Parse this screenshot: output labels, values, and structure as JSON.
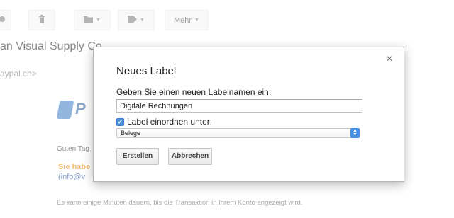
{
  "background": {
    "toolbar": {
      "more_label": "Mehr"
    },
    "subject": "an Visual Supply Co",
    "sender": "aypal.ch>",
    "logo_text": "P",
    "side_mark": "z\nz",
    "greeting": "Guten Tag",
    "orange_text": "Sie habe",
    "link_text": "(info@v",
    "note": "Es kann einige Minuten dauern, bis die Transaktion in Ihrem Konto angezeigt wird."
  },
  "dialog": {
    "title": "Neues Label",
    "prompt": "Geben Sie einen neuen Labelnamen ein:",
    "name_value": "Digitale Rechnungen",
    "nest_label": "Label einordnen unter:",
    "nest_checked": true,
    "parent_selected": "Belege",
    "create_label": "Erstellen",
    "cancel_label": "Abbrechen",
    "close_symbol": "×"
  },
  "colors": {
    "accent": "#4a90e2",
    "paypal_blue": "#2d5fa0",
    "orange": "#e68a00"
  }
}
